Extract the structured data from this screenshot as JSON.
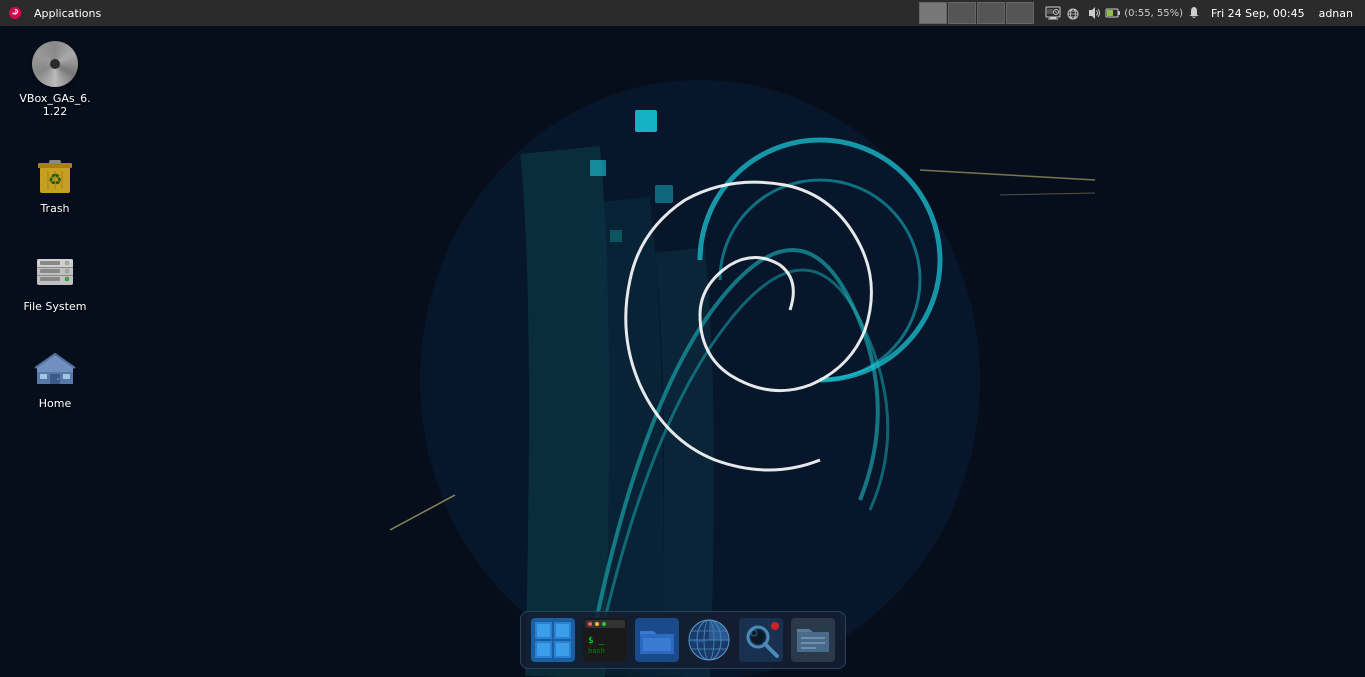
{
  "panel": {
    "appMenu": "Applications",
    "clock": "Fri 24 Sep, 00:45",
    "user": "adnan",
    "battery": "(0:55, 55%)",
    "workspaces": [
      "1",
      "2",
      "3",
      "4"
    ]
  },
  "desktopIcons": [
    {
      "id": "vbox",
      "label": "VBox_GAs_6.\n1.22",
      "type": "cd"
    },
    {
      "id": "trash",
      "label": "Trash",
      "type": "trash"
    },
    {
      "id": "filesystem",
      "label": "File System",
      "type": "filesystem"
    },
    {
      "id": "home",
      "label": "Home",
      "type": "home"
    }
  ],
  "taskbar": {
    "items": [
      {
        "id": "xfce-panel",
        "label": "XFCE Panel",
        "type": "xfce"
      },
      {
        "id": "terminal",
        "label": "Terminal",
        "type": "terminal"
      },
      {
        "id": "thunar",
        "label": "File Manager",
        "type": "files"
      },
      {
        "id": "browser",
        "label": "Web Browser",
        "type": "browser"
      },
      {
        "id": "search",
        "label": "Search",
        "type": "search"
      },
      {
        "id": "fm2",
        "label": "File Manager 2",
        "type": "fm"
      }
    ]
  }
}
